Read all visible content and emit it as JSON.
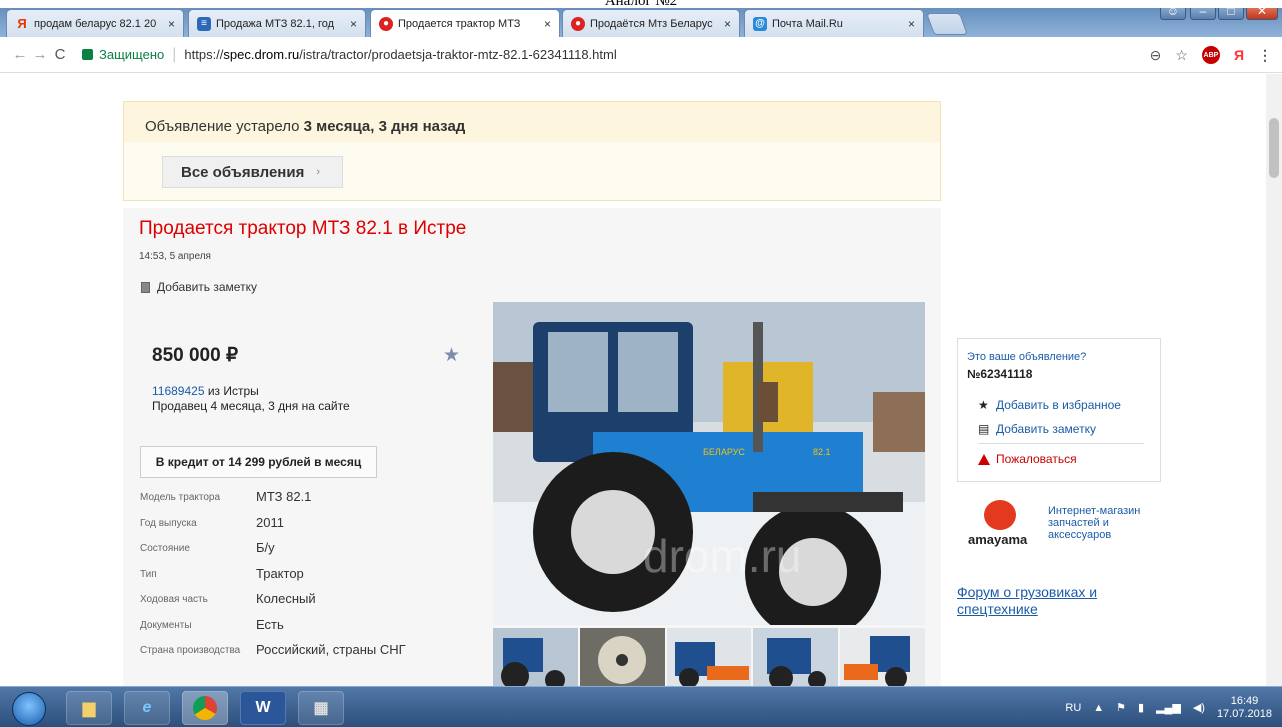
{
  "doc_header": "Аналог №2",
  "tabs": [
    {
      "label": "продам беларус 82.1 20",
      "icon": "yandex-icon"
    },
    {
      "label": "Продажа МТЗ 82.1, год",
      "icon": "doc-icon"
    },
    {
      "label": "Продается трактор МТЗ",
      "icon": "drom-icon",
      "active": true
    },
    {
      "label": "Продаётся Мтз Беларус",
      "icon": "drom-icon"
    },
    {
      "label": "Почта Mail.Ru",
      "icon": "mail-icon"
    }
  ],
  "address_bar": {
    "secure_label": "Защищено",
    "url_prefix": "https://",
    "url_domain": "spec.drom.ru",
    "url_path": "/istra/tractor/prodaetsja-traktor-mtz-82.1-62341118.html"
  },
  "notice": {
    "text_prefix": "Объявление устарело",
    "text_bold": "3 месяца, 3 дня назад",
    "all_ads_label": "Все объявления",
    "all_ads_chevron": "›"
  },
  "listing": {
    "title": "Продается трактор МТЗ 82.1 в Истре",
    "date": "14:53, 5 апреля",
    "add_note": "Добавить заметку",
    "price": "850 000 ₽",
    "seller_id": "11689425",
    "seller_city": " из Истры",
    "seller_age": "Продавец 4 месяца, 3 дня на сайте",
    "credit_button": "В кредит от 14 299 рублей в месяц",
    "specs": [
      {
        "key": "Модель трактора",
        "value": "МТЗ 82.1"
      },
      {
        "key": "Год выпуска",
        "value": "2011"
      },
      {
        "key": "Состояние",
        "value": "Б/у"
      },
      {
        "key": "Тип",
        "value": "Трактор"
      },
      {
        "key": "Ходовая часть",
        "value": "Колесный"
      },
      {
        "key": "Документы",
        "value": "Есть"
      },
      {
        "key": "Страна производства",
        "value": "Российский, страны СНГ"
      }
    ],
    "photo_watermark": "drom.ru",
    "tractor_brand": "БЕЛАРУС",
    "tractor_model": "82.1"
  },
  "sidebar": {
    "your_ad": "Это ваше объявление?",
    "ad_number": "№62341118",
    "add_favorite": "Добавить в избранное",
    "add_note": "Добавить заметку",
    "complain": "Пожаловаться",
    "amayama_name": "amayama",
    "amayama_link": "Интернет-магазин запчастей и аксессуаров",
    "forum_link": "Форум о грузовиках и спецтехнике"
  },
  "taskbar": {
    "lang": "RU",
    "time": "16:49",
    "date": "17.07.2018",
    "word_label": "W"
  },
  "colors": {
    "title_red": "#d00000",
    "link_blue": "#1b5ba8",
    "notice_bg": "#fdf5dd",
    "secure_green": "#0b8043"
  }
}
